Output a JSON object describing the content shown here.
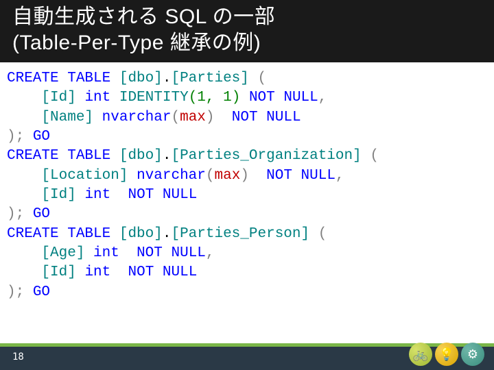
{
  "title_line1": "自動生成される SQL の一部",
  "title_line2": "(Table-Per-Type 継承の例)",
  "page_number": "18",
  "sql": {
    "kw_create_table": "CREATE TABLE",
    "kw_int": "int",
    "kw_identity": "IDENTITY",
    "kw_nvarchar": "nvarchar",
    "kw_not_null": "NOT NULL",
    "kw_go": "GO",
    "kw_max": "max",
    "paren_open": "(",
    "paren_close": ")",
    "comma": ",",
    "semicolon_stmt_end": ");",
    "dot": ".",
    "schema": "[dbo]",
    "t1": {
      "name": "[Parties]",
      "col_id": "[Id]",
      "identity_args": "(1, 1)",
      "col_name": "[Name]"
    },
    "t2": {
      "name": "[Parties_Organization]",
      "col_location": "[Location]",
      "col_id": "[Id]"
    },
    "t3": {
      "name": "[Parties_Person]",
      "col_age": "[Age]",
      "col_id": "[Id]"
    }
  },
  "badges": {
    "b1": "bike-icon",
    "b2": "bulb-icon",
    "b3": "gear-icon"
  }
}
